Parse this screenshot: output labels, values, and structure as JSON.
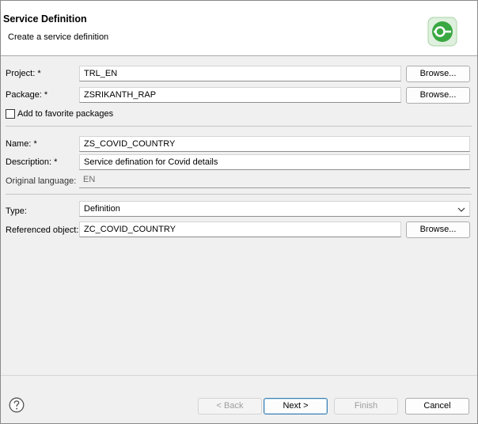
{
  "header": {
    "title": "Service Definition",
    "subtitle": "Create a service definition",
    "icon": "service-definition-icon",
    "accent": "#3aa842"
  },
  "form": {
    "project": {
      "label": "Project: *",
      "value": "TRL_EN",
      "browse": "Browse..."
    },
    "package": {
      "label": "Package: *",
      "value": "ZSRIKANTH_RAP",
      "browse": "Browse..."
    },
    "favorites": {
      "label": "Add to favorite packages",
      "checked": false
    },
    "name": {
      "label": "Name: *",
      "value": "ZS_COVID_COUNTRY"
    },
    "description": {
      "label": "Description: *",
      "value": "Service defination for Covid details"
    },
    "language": {
      "label": "Original language:",
      "value": "EN"
    },
    "type": {
      "label": "Type:",
      "value": "Definition"
    },
    "referenced": {
      "label": "Referenced object:",
      "value": "ZC_COVID_COUNTRY",
      "browse": "Browse..."
    }
  },
  "footer": {
    "help_icon": "help-icon",
    "back": "< Back",
    "next": "Next >",
    "finish": "Finish",
    "cancel": "Cancel"
  }
}
